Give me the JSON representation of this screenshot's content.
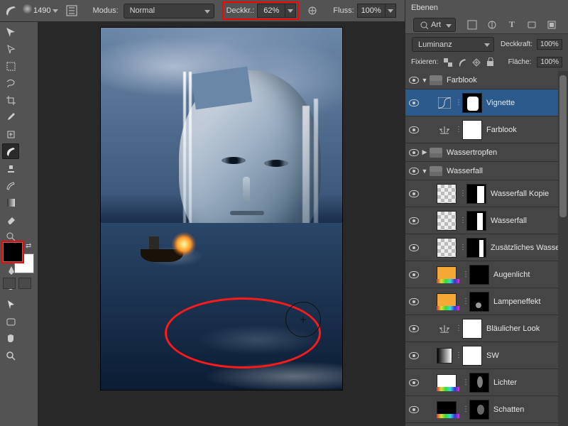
{
  "optbar": {
    "brush_size": "1490",
    "mode_label": "Modus:",
    "mode_value": "Normal",
    "opacity_label": "Deckkr.:",
    "opacity_value": "62%",
    "flow_label": "Fluss:",
    "flow_value": "100%"
  },
  "colors": {
    "fg": "#000000",
    "bg": "#ffffff",
    "highlight": "#ff0000"
  },
  "panels": {
    "title": "Ebenen",
    "filter_label": "Art",
    "blend_mode": "Luminanz",
    "opacity_label": "Deckkraft:",
    "opacity_value": "100%",
    "lock_label": "Fixieren:",
    "fill_label": "Fläche:",
    "fill_value": "100%"
  },
  "groups": {
    "g1": "Farblook",
    "g2": "Wassertropfen",
    "g3": "Wasserfall"
  },
  "layers": {
    "l1": "Vignette",
    "l2": "Farblook",
    "l3": "Wasserfall Kopie",
    "l4": "Wasserfall",
    "l5": "Zusätzliches Wasser",
    "l6": "Augenlicht",
    "l7": "Lampeneffekt",
    "l8": "Bläulicher Look",
    "l9": "SW",
    "l10": "Lichter",
    "l11": "Schatten"
  }
}
